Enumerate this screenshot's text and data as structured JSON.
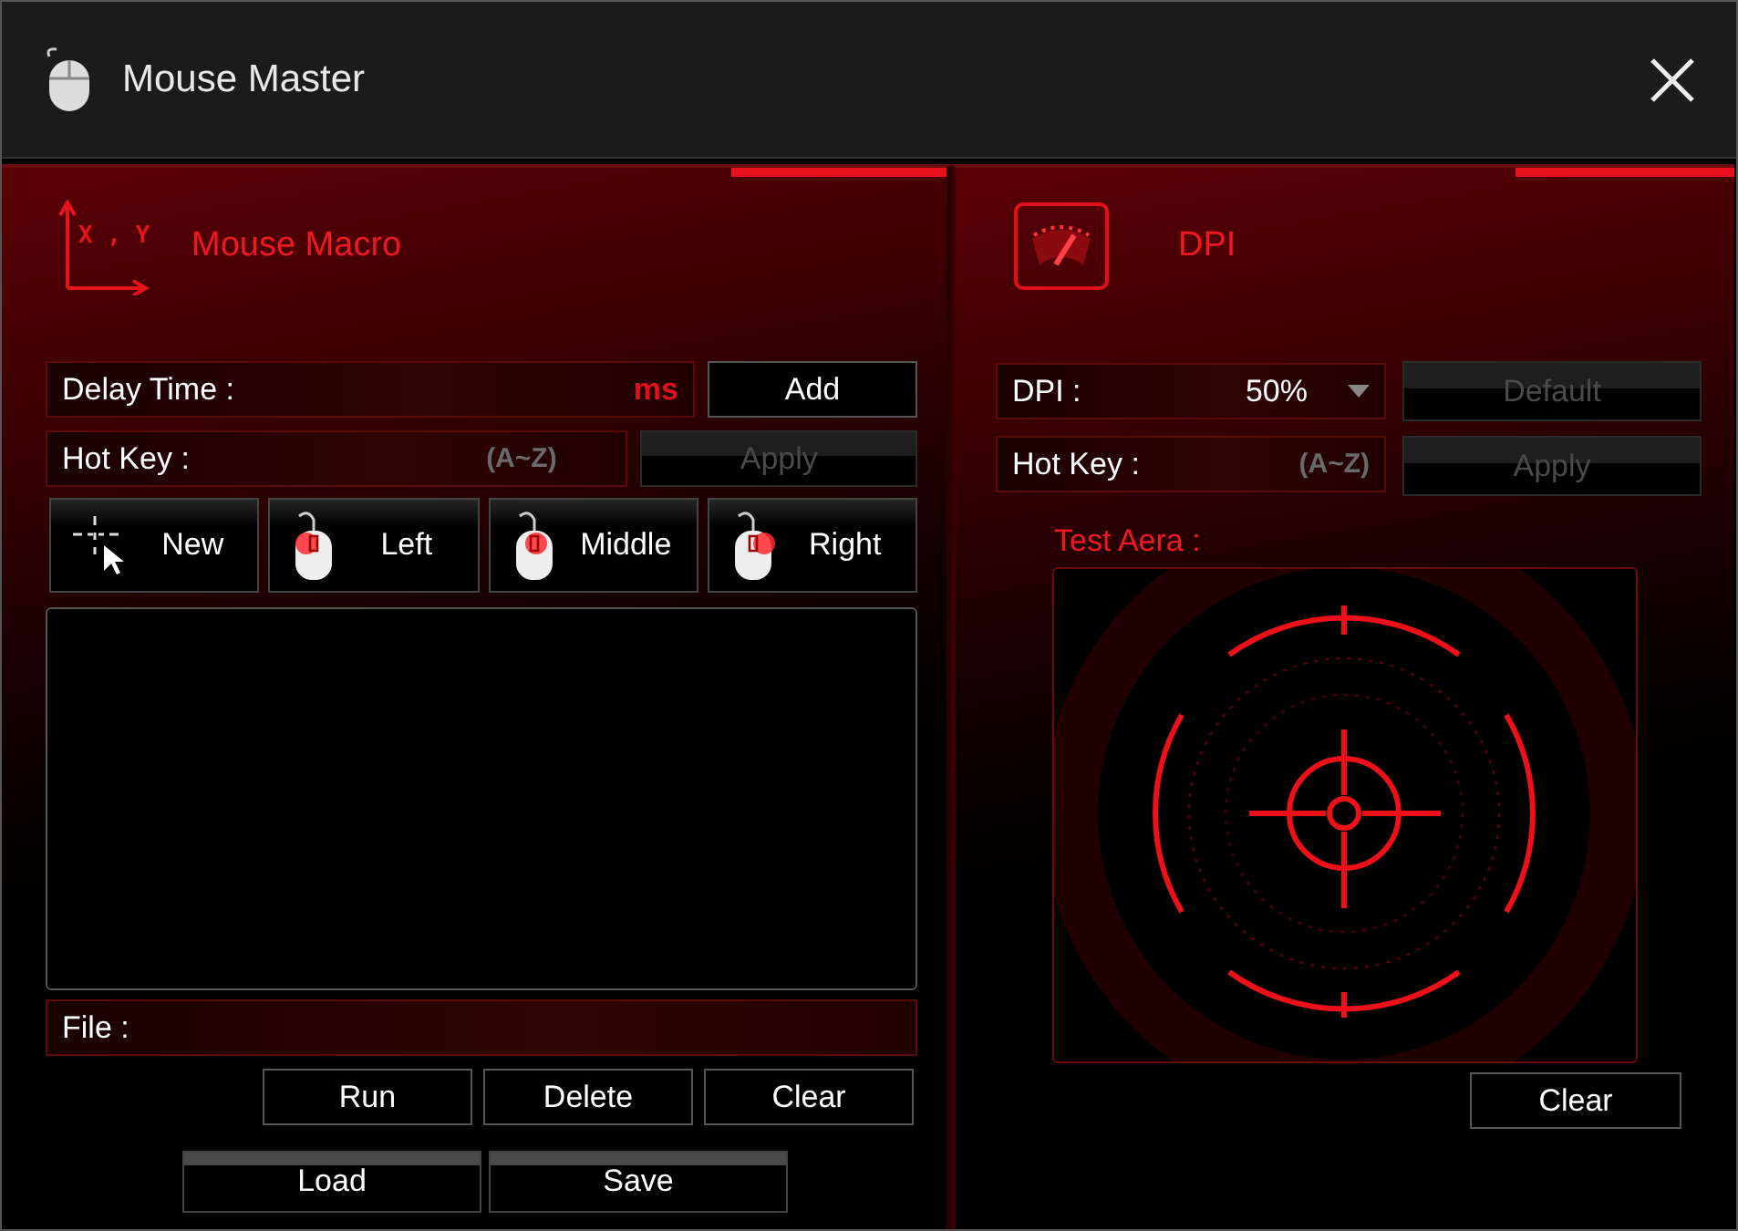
{
  "window": {
    "title": "Mouse Master"
  },
  "macro": {
    "title": "Mouse Macro",
    "icon_text": "X , Y",
    "delay": {
      "label": "Delay Time :",
      "unit": "ms"
    },
    "add": {
      "label": "Add",
      "disabled": false
    },
    "hotkey": {
      "label": "Hot Key :",
      "hint": "(A~Z)"
    },
    "apply": {
      "label": "Apply",
      "disabled": true
    },
    "buttons": [
      {
        "label": "New",
        "kind": "cursor"
      },
      {
        "label": "Left",
        "kind": "left"
      },
      {
        "label": "Middle",
        "kind": "middle"
      },
      {
        "label": "Right",
        "kind": "right"
      }
    ],
    "file": {
      "label": "File :"
    },
    "actions": [
      {
        "label": "Run"
      },
      {
        "label": "Delete"
      },
      {
        "label": "Clear"
      }
    ],
    "storage": [
      {
        "label": "Load"
      },
      {
        "label": "Save"
      }
    ]
  },
  "dpi": {
    "title": "DPI",
    "select": {
      "label": "DPI :",
      "value": "50%"
    },
    "default": {
      "label": "Default",
      "disabled": true
    },
    "hotkey": {
      "label": "Hot Key :",
      "hint": "(A~Z)"
    },
    "apply": {
      "label": "Apply",
      "disabled": true
    },
    "test_area": {
      "label": "Test Aera :"
    },
    "clear": {
      "label": "Clear"
    }
  }
}
